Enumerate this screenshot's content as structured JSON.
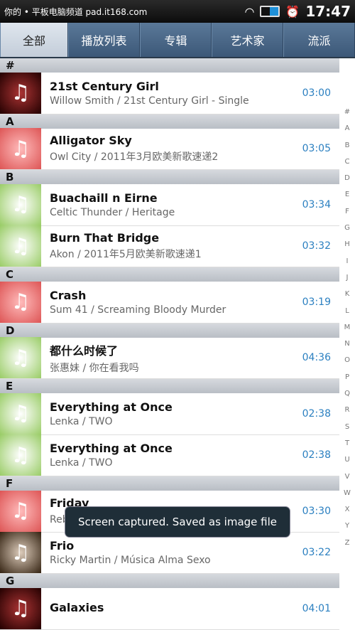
{
  "status_bar": {
    "title": "你的 • 平板电脑频道 pad.it168.com",
    "time": "17:47"
  },
  "tabs": [
    "全部",
    "播放列表",
    "专辑",
    "艺术家",
    "流派"
  ],
  "sections": [
    {
      "letter": "#",
      "songs": [
        {
          "title": "21st Century Girl",
          "sub": "Willow Smith  /  21st Century Girl - Single",
          "duration": "03:00",
          "art": "dark"
        }
      ]
    },
    {
      "letter": "A",
      "songs": [
        {
          "title": "Alligator Sky",
          "sub": "Owl City  /  2011年3月欧美新歌速递2",
          "duration": "03:05",
          "art": "pink"
        }
      ]
    },
    {
      "letter": "B",
      "songs": [
        {
          "title": "Buachaill n Eirne",
          "sub": "Celtic Thunder  /  Heritage",
          "duration": "03:34",
          "art": "green"
        },
        {
          "title": "Burn That Bridge",
          "sub": "Akon  /  2011年5月欧美新歌速递1",
          "duration": "03:32",
          "art": "green"
        }
      ]
    },
    {
      "letter": "C",
      "songs": [
        {
          "title": "Crash",
          "sub": "Sum 41  /  Screaming Bloody Murder",
          "duration": "03:19",
          "art": "pink"
        }
      ]
    },
    {
      "letter": "D",
      "songs": [
        {
          "title": "都什么时候了",
          "sub": "张惠妹  /  你在看我吗",
          "duration": "04:36",
          "art": "green"
        }
      ]
    },
    {
      "letter": "E",
      "songs": [
        {
          "title": "Everything at Once",
          "sub": "Lenka  /  TWO",
          "duration": "02:38",
          "art": "green"
        },
        {
          "title": "Everything at Once",
          "sub": "Lenka  /  TWO",
          "duration": "02:38",
          "art": "green"
        }
      ]
    },
    {
      "letter": "F",
      "songs": [
        {
          "title": "Friday",
          "sub": "Rebecca Black  /  2011年3月欧美新歌速递1",
          "duration": "03:30",
          "art": "pink"
        },
        {
          "title": "Frio",
          "sub": "Ricky Martin  /  Música   Alma   Sexo",
          "duration": "03:22",
          "art": "gold"
        }
      ]
    },
    {
      "letter": "G",
      "songs": [
        {
          "title": "Galaxies",
          "sub": "",
          "duration": "04:01",
          "art": "dark"
        }
      ]
    }
  ],
  "index": [
    "#",
    "A",
    "B",
    "C",
    "D",
    "E",
    "F",
    "G",
    "H",
    "I",
    "J",
    "K",
    "L",
    "M",
    "N",
    "O",
    "P",
    "Q",
    "R",
    "S",
    "T",
    "U",
    "V",
    "W",
    "X",
    "Y",
    "Z"
  ],
  "toast": "Screen captured. Saved as image file",
  "colors": {
    "accent": "#2a7fc0",
    "tab_bar": "#4a6888"
  }
}
